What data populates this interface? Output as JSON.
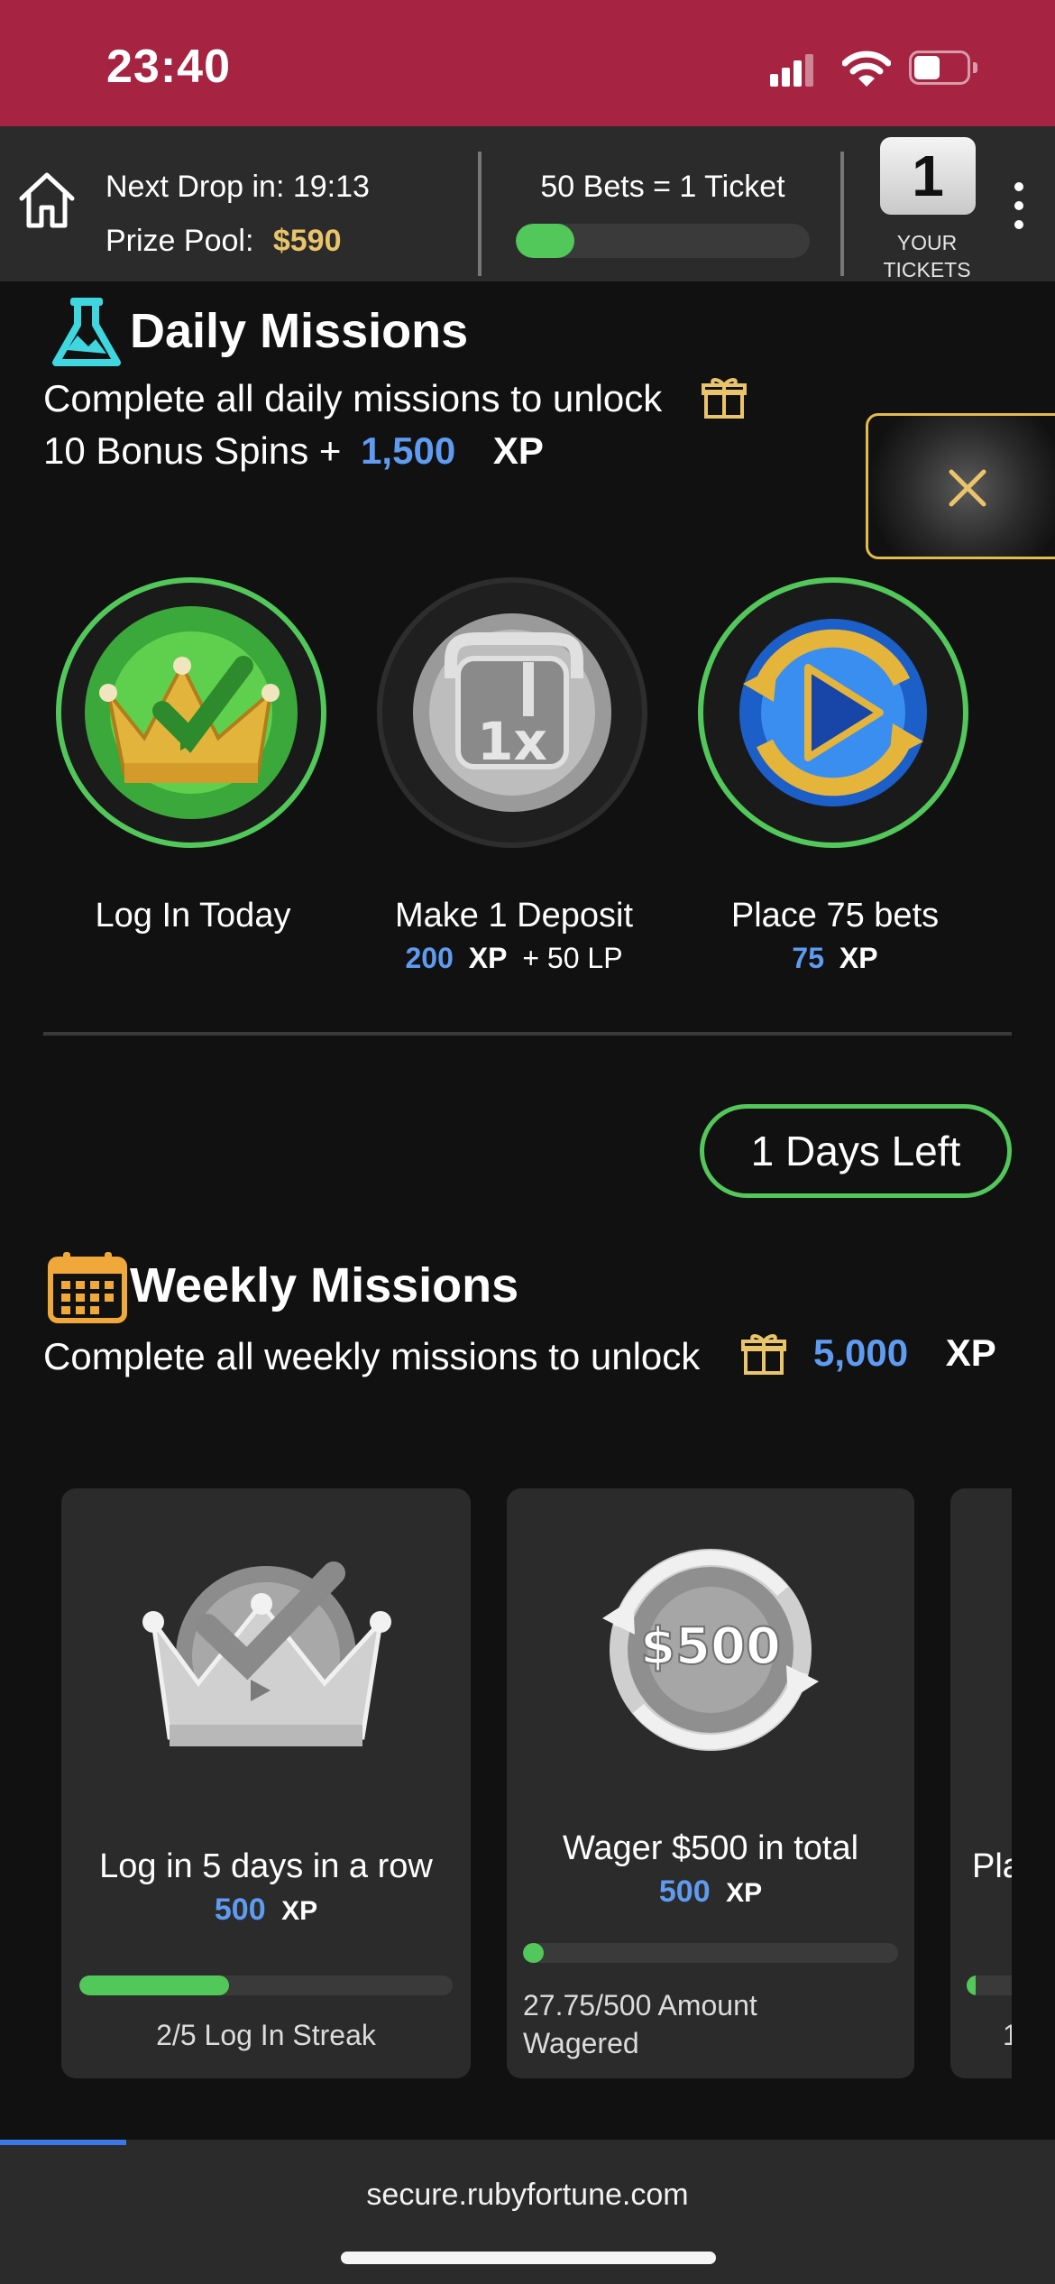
{
  "status_bar": {
    "time": "23:40"
  },
  "top_bar": {
    "next_drop_label": "Next Drop in: 19:13",
    "prize_pool_label": "Prize Pool:",
    "prize_pool_value": "$590",
    "bets_ticket_label": "50 Bets = 1 Ticket",
    "bets_progress": 0.2,
    "ticket_count": "1",
    "tickets_label_1": "YOUR",
    "tickets_label_2": "TICKETS"
  },
  "daily": {
    "title": "Daily Missions",
    "line1": "Complete all daily missions to unlock",
    "line2_prefix": "10 Bonus Spins +",
    "line2_xp": "1,500",
    "xp_label": "XP",
    "missions": [
      {
        "label": "Log In Today",
        "icon": "crown-check-icon",
        "completed": true
      },
      {
        "label": "Make 1 Deposit",
        "reward_xp": "200",
        "reward_xp_label": "XP",
        "reward_extra": "+ 50 LP",
        "icon": "deposit-1x-icon",
        "completed": false
      },
      {
        "label": "Place 75 bets",
        "reward_xp": "75",
        "reward_xp_label": "XP",
        "icon": "play-cycle-icon",
        "completed": true
      }
    ]
  },
  "days_left": "1 Days Left",
  "weekly": {
    "title": "Weekly Missions",
    "line1": "Complete all weekly missions to unlock",
    "reward_xp": "5,000",
    "xp_label": "XP",
    "cards": [
      {
        "title": "Log in 5 days in a row",
        "reward_xp": "500",
        "xp_label": "XP",
        "progress": 0.4,
        "progress_text": "2/5 Log In Streak",
        "icon": "crown-check-silver-icon"
      },
      {
        "title": "Wager $500 in total",
        "reward_xp": "500",
        "xp_label": "XP",
        "progress": 0.0555,
        "progress_text_1": "27.75/500 Amount",
        "progress_text_2": "Wagered",
        "icon": "wager-500-icon",
        "badge": "$500"
      },
      {
        "title_partial": "Pla",
        "progress_partial": "1"
      }
    ]
  },
  "browser": {
    "url": "secure.rubyfortune.com"
  },
  "colors": {
    "status_bar": "#a62341",
    "accent_green": "#52c75a",
    "xp_blue": "#5f9bf0",
    "gold": "#e9c46a"
  }
}
